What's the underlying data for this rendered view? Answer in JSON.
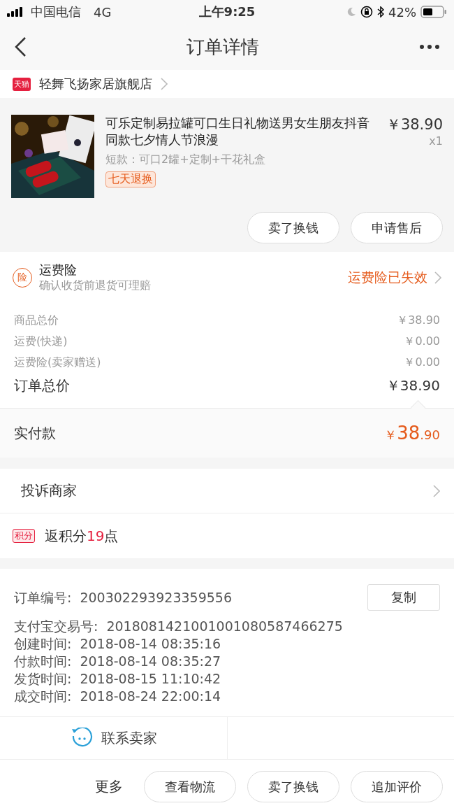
{
  "status_bar": {
    "carrier": "中国电信",
    "network": "4G",
    "time": "上午9:25",
    "battery": "42%"
  },
  "nav": {
    "title": "订单详情"
  },
  "shop": {
    "badge": "天猫",
    "name": "轻舞飞扬家居旗舰店"
  },
  "product": {
    "title": "可乐定制易拉罐可口生日礼物送男女生朋友抖音同款七夕情人节浪漫",
    "sku": "短款：可口2罐+定制+干花礼盒",
    "tag": "七天退换",
    "price": "￥38.90",
    "quantity": "x1",
    "actions": [
      "卖了换钱",
      "申请售后"
    ]
  },
  "insurance": {
    "icon_text": "险",
    "title": "运费险",
    "subtitle": "确认收货前退货可理赔",
    "status": "运费险已失效"
  },
  "costs": [
    {
      "kind": "minor",
      "label": "商品总价",
      "value": "￥38.90"
    },
    {
      "kind": "minor",
      "label": "运费(快递)",
      "value": "￥0.00"
    },
    {
      "kind": "minor",
      "label": "运费险(卖家赠送)",
      "value": "￥0.00"
    },
    {
      "kind": "total",
      "label": "订单总价",
      "value": "￥38.90"
    }
  ],
  "paid": {
    "label": "实付款",
    "currency": "￥",
    "integer": "38",
    "decimal": ".90"
  },
  "complaint": {
    "label": "投诉商家"
  },
  "points": {
    "badge": "积分",
    "prefix": "返积分",
    "amount": "19",
    "suffix": "点"
  },
  "order_info": {
    "copy_button": "复制",
    "rows": [
      {
        "label": "订单编号:",
        "value": "200302293923359556"
      },
      {
        "label": "支付宝交易号:",
        "value": "2018081421001001080587466275"
      },
      {
        "label": "创建时间:",
        "value": "2018-08-14 08:35:16"
      },
      {
        "label": "付款时间:",
        "value": "2018-08-14 08:35:27"
      },
      {
        "label": "发货时间:",
        "value": "2018-08-15 11:10:42"
      },
      {
        "label": "成交时间:",
        "value": "2018-08-24 22:00:14"
      }
    ]
  },
  "contact": {
    "label": "联系卖家"
  },
  "bottom_bar": {
    "more": "更多",
    "buttons": [
      "查看物流",
      "卖了换钱",
      "追加评价"
    ]
  }
}
